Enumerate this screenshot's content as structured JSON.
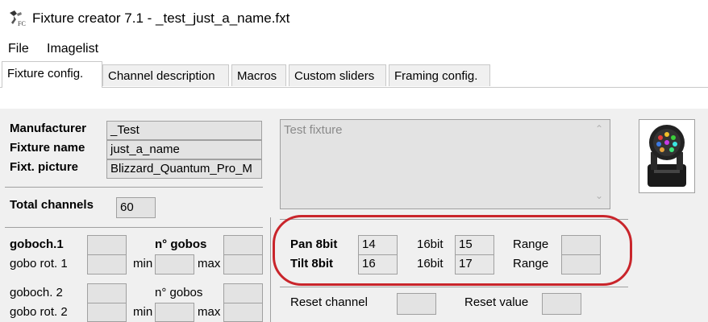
{
  "window": {
    "title": "Fixture creator 7.1 - _test_just_a_name.fxt"
  },
  "menu": [
    "File",
    "Imagelist"
  ],
  "tabs": [
    "Fixture config.",
    "Channel description",
    "Macros",
    "Custom sliders",
    "Framing config."
  ],
  "fixture": {
    "manufacturer_label": "Manufacturer",
    "manufacturer_value": "_Test",
    "name_label": "Fixture name",
    "name_value": "just_a_name",
    "picture_label": "Fixt. picture",
    "picture_value": "Blizzard_Quantum_Pro_M",
    "total_channels_label": "Total channels",
    "total_channels_value": "60",
    "description": "Test fixture"
  },
  "gobo": {
    "goboch1_label": "goboch.1",
    "ngobos1_label": "n° gobos",
    "gobo_rot1_label": "gobo rot. 1",
    "min_label": "min",
    "max_label": "max",
    "goboch2_label": "goboch. 2",
    "ngobos2_label": "n° gobos",
    "gobo_rot2_label": "gobo rot. 2"
  },
  "pantilt": {
    "pan_label": "Pan 8bit",
    "pan_value": "14",
    "pan_16bit_label": "16bit",
    "pan_16bit_value": "15",
    "pan_range_label": "Range",
    "tilt_label": "Tilt 8bit",
    "tilt_value": "16",
    "tilt_16bit_label": "16bit",
    "tilt_16bit_value": "17",
    "tilt_range_label": "Range"
  },
  "reset": {
    "channel_label": "Reset channel",
    "value_label": "Reset value"
  },
  "colors": {
    "highlight": "#c9252b",
    "panel": "#f0f0f0",
    "field": "#e3e3e3"
  },
  "icons": [
    "moving-head-app-icon",
    "fixture-picture"
  ]
}
